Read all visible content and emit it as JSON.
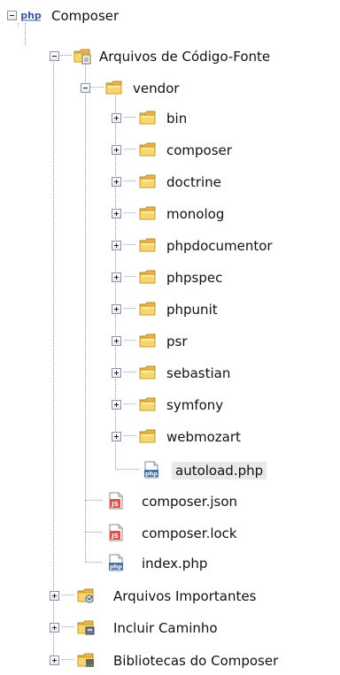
{
  "tree": {
    "root": {
      "label": "Composer",
      "icon": "php-project-icon",
      "expanded": true
    },
    "source_files": {
      "label": "Arquivos de Código-Fonte",
      "icon": "source-folder-icon",
      "expanded": true
    },
    "vendor": {
      "label": "vendor",
      "icon": "folder-icon",
      "expanded": true
    },
    "vendor_children": [
      {
        "label": "bin",
        "icon": "folder-icon"
      },
      {
        "label": "composer",
        "icon": "folder-icon"
      },
      {
        "label": "doctrine",
        "icon": "folder-icon"
      },
      {
        "label": "monolog",
        "icon": "folder-icon"
      },
      {
        "label": "phpdocumentor",
        "icon": "folder-icon"
      },
      {
        "label": "phpspec",
        "icon": "folder-icon"
      },
      {
        "label": "phpunit",
        "icon": "folder-icon"
      },
      {
        "label": "psr",
        "icon": "folder-icon"
      },
      {
        "label": "sebastian",
        "icon": "folder-icon"
      },
      {
        "label": "symfony",
        "icon": "folder-icon"
      },
      {
        "label": "webmozart",
        "icon": "folder-icon"
      }
    ],
    "autoload": {
      "label": "autoload.php",
      "icon": "php-file-icon",
      "selected": true
    },
    "source_children": [
      {
        "label": "composer.json",
        "icon": "js-file-icon"
      },
      {
        "label": "composer.lock",
        "icon": "js-file-icon"
      },
      {
        "label": "index.php",
        "icon": "php-file-icon"
      }
    ],
    "other_nodes": [
      {
        "label": "Arquivos Importantes",
        "icon": "important-files-icon"
      },
      {
        "label": "Incluir Caminho",
        "icon": "include-path-icon"
      },
      {
        "label": "Bibliotecas do Composer",
        "icon": "composer-libraries-icon"
      }
    ]
  }
}
